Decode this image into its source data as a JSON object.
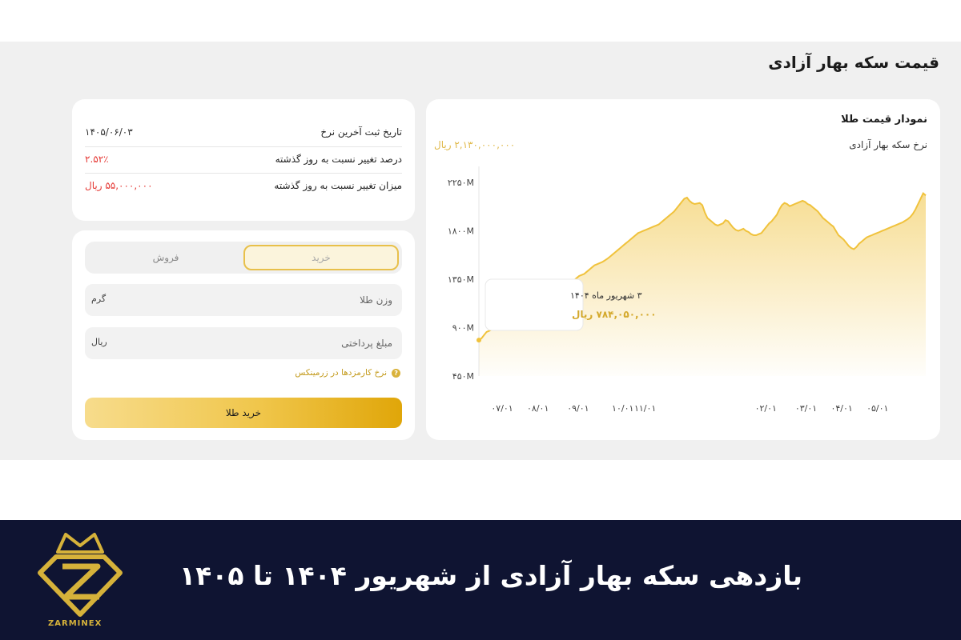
{
  "page": {
    "title": "قیمت سکه بهار آزادی"
  },
  "info": {
    "rows": [
      {
        "label": "تاریخ ثبت آخرین نرخ",
        "value": "۱۴۰۵/۰۶/۰۳"
      },
      {
        "label": "درصد تغییر نسبت به روز گذشته",
        "value": "۲.۵۲٪"
      },
      {
        "label": "میزان تغییر نسبت به روز گذشته",
        "value": "۵۵,۰۰۰,۰۰۰ ریال"
      }
    ]
  },
  "trade": {
    "tabs": {
      "buy": "خرید",
      "sell": "فروش"
    },
    "active_tab": "buy",
    "weight": {
      "placeholder": "وزن طلا",
      "unit": "گرم"
    },
    "amount": {
      "placeholder": "مبلغ پرداختی",
      "unit": "ریال"
    },
    "fee_note": "نرخ کارمزدها در زرمینکس",
    "buy_button": "خرید طلا"
  },
  "chart": {
    "title": "نمودار قیمت طلا",
    "subtitle": "نرخ سکه بهار آزادی",
    "current_price": "۲,۱۳۰,۰۰۰,۰۰۰ ریال",
    "tooltip": {
      "date": "۳ شهریور ماه ۱۴۰۴",
      "value": "۷۸۴,۰۵۰,۰۰۰ ریال"
    }
  },
  "chart_data": {
    "type": "area",
    "y_ticks": [
      "۲۲۵۰M",
      "۱۸۰۰M",
      "۱۳۵۰M",
      "۹۰۰M",
      "۴۵۰M"
    ],
    "y_tick_values": [
      2250,
      1800,
      1350,
      900,
      450
    ],
    "x_ticks": [
      "۰۷/۰۱",
      "۰۸/۰۱",
      "۰۹/۰۱",
      "۱۰/۰۱",
      "۱۱/۰۱",
      "۰۲/۰۱",
      "۰۳/۰۱",
      "۰۴/۰۱",
      "۰۵/۰۱"
    ],
    "x_tick_positions": [
      0.07,
      0.15,
      0.24,
      0.34,
      0.39,
      0.66,
      0.75,
      0.83,
      0.91
    ],
    "ylim": [
      450,
      2400
    ],
    "series": [
      {
        "values": [
          784,
          800,
          830,
          860,
          870,
          880,
          885,
          890,
          900,
          905,
          910,
          920,
          930,
          940,
          950,
          960,
          975,
          985,
          995,
          1005,
          1020,
          1040,
          1060,
          1080,
          1095,
          1110,
          1130,
          1150,
          1170,
          1180,
          1200,
          1220,
          1240,
          1260,
          1280,
          1300,
          1320,
          1340,
          1360,
          1380,
          1390,
          1400,
          1420,
          1440,
          1460,
          1480,
          1490,
          1500,
          1510,
          1525,
          1540,
          1560,
          1580,
          1600,
          1620,
          1640,
          1660,
          1680,
          1700,
          1720,
          1740,
          1760,
          1780,
          1790,
          1800,
          1810,
          1820,
          1830,
          1840,
          1850,
          1860,
          1880,
          1900,
          1920,
          1940,
          1960,
          1980,
          2010,
          2040,
          2070,
          2100,
          2110,
          2080,
          2060,
          2050,
          2055,
          2060,
          2040,
          1970,
          1920,
          1900,
          1880,
          1860,
          1850,
          1860,
          1870,
          1900,
          1890,
          1860,
          1830,
          1810,
          1800,
          1810,
          1820,
          1800,
          1790,
          1770,
          1760,
          1760,
          1770,
          1780,
          1810,
          1840,
          1870,
          1890,
          1920,
          1950,
          2000,
          2040,
          2060,
          2050,
          2030,
          2040,
          2050,
          2060,
          2070,
          2080,
          2070,
          2050,
          2040,
          2020,
          2000,
          1980,
          1950,
          1920,
          1900,
          1880,
          1860,
          1840,
          1800,
          1760,
          1740,
          1720,
          1690,
          1660,
          1640,
          1630,
          1650,
          1680,
          1700,
          1720,
          1740,
          1750,
          1760,
          1770,
          1780,
          1790,
          1800,
          1810,
          1820,
          1830,
          1840,
          1850,
          1860,
          1870,
          1880,
          1895,
          1910,
          1930,
          1960,
          2000,
          2050,
          2100,
          2150,
          2130
        ]
      }
    ],
    "grid": false
  },
  "footer": {
    "headline": "بازدهی سکه بهار آزادی از شهریور ۱۴۰۴ تا ۱۴۰۵",
    "brand": "ZARMINEX"
  },
  "colors": {
    "accent": "#e0b94a",
    "line": "#f0c23c",
    "negative": "#e53935",
    "footer_bg": "#0f1432",
    "section_bg": "#f0f0f0"
  }
}
